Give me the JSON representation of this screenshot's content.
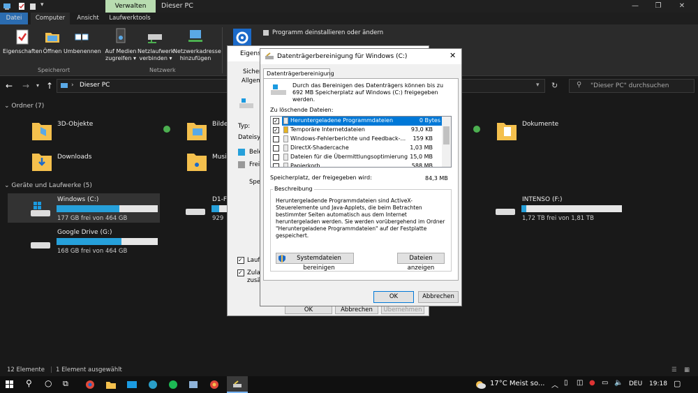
{
  "titlebar": {
    "manage_tab": "Verwalten",
    "title": "Dieser PC"
  },
  "menubar": {
    "tabs": [
      "Datei",
      "Computer",
      "Ansicht",
      "Laufwerktools"
    ]
  },
  "ribbon": {
    "buttons": [
      {
        "label": "Eigenschaften"
      },
      {
        "label": "Öffnen"
      },
      {
        "label": "Umbenennen"
      },
      {
        "label": "Auf Medien\nzugreifen ▾"
      },
      {
        "label": "Netzlaufwerk\nverbinden ▾"
      },
      {
        "label": "Netzwerkadresse\nhinzufügen"
      }
    ],
    "groups": {
      "location": "Speicherort",
      "network": "Netzwerk"
    },
    "system_item": "Programm deinstallieren oder ändern"
  },
  "address": {
    "path": "Dieser PC",
    "search_placeholder": "\"Dieser PC\" durchsuchen"
  },
  "folders": {
    "header": "Ordner (7)",
    "items": [
      "3D-Objekte",
      "Bilder",
      "Dokumente",
      "Downloads",
      "Musik"
    ]
  },
  "drives": {
    "header": "Geräte und Laufwerke (5)",
    "items": [
      {
        "name": "Windows (C:)",
        "free": "177 GB frei von 464 GB",
        "used": 0.62
      },
      {
        "name": "D1-F",
        "free": "929",
        "used": 0.5
      },
      {
        "name": "INTENSO (F:)",
        "free": "1,72 TB frei von 1,81 TB",
        "used": 0.05
      },
      {
        "name": "Google Drive (G:)",
        "free": "168 GB frei von 464 GB",
        "used": 0.64
      }
    ]
  },
  "statusbar": {
    "count": "12 Elemente",
    "selected": "1 Element ausgewählt"
  },
  "taskbar": {
    "weather": "17°C  Meist so...",
    "lang": "DEU",
    "time": "19:18"
  },
  "back_dialog": {
    "title": "Eigens",
    "tab1": "Sicher",
    "tab2": "Allgem",
    "type_label": "Typ:",
    "fs_label": "Dateisys",
    "used_label": "Bele",
    "free_label": "Frei",
    "space_label": "Spei",
    "opt1": "Lauf",
    "opt2a": "Zulas",
    "opt2b": "zusät",
    "ok": "OK",
    "cancel": "Abbrechen",
    "apply": "Übernehmen"
  },
  "dialog": {
    "title": "Datenträgerbereinigung für Windows (C:)",
    "tab": "Datenträgerbereinigung",
    "intro": "Durch das Bereinigen des Datenträgers können bis zu 692 MB Speicherplatz auf Windows (C:) freigegeben werden.",
    "files_label": "Zu löschende Dateien:",
    "files": [
      {
        "name": "Heruntergeladene Programmdateien",
        "size": "0 Bytes",
        "checked": true
      },
      {
        "name": "Temporäre Internetdateien",
        "size": "93,0 KB",
        "checked": true
      },
      {
        "name": "Windows-Fehlerberichte und Feedback-...",
        "size": "159 KB",
        "checked": false
      },
      {
        "name": "DirectX-Shadercache",
        "size": "1,03 MB",
        "checked": false
      },
      {
        "name": "Dateien für die Übermittlungsoptimierung",
        "size": "15,0 MB",
        "checked": false
      },
      {
        "name": "Papierkorb",
        "size": "588 MB",
        "checked": false
      }
    ],
    "gain_label": "Speicherplatz, der freigegeben wird:",
    "gain_value": "84,3 MB",
    "desc_group": "Beschreibung",
    "desc": "Heruntergeladende Programmdateien sind ActiveX-Steuerelemente und Java-Applets, die beim Betrachten bestimmter Seiten automatisch aus dem Internet heruntergeladen werden. Sie werden vorübergehend im Ordner \"Heruntergeladene Programmdateien\" auf der Festplatte gespeichert.",
    "sys_btn": "Systemdateien bereinigen",
    "view_btn": "Dateien anzeigen",
    "ok": "OK",
    "cancel": "Abbrechen"
  }
}
